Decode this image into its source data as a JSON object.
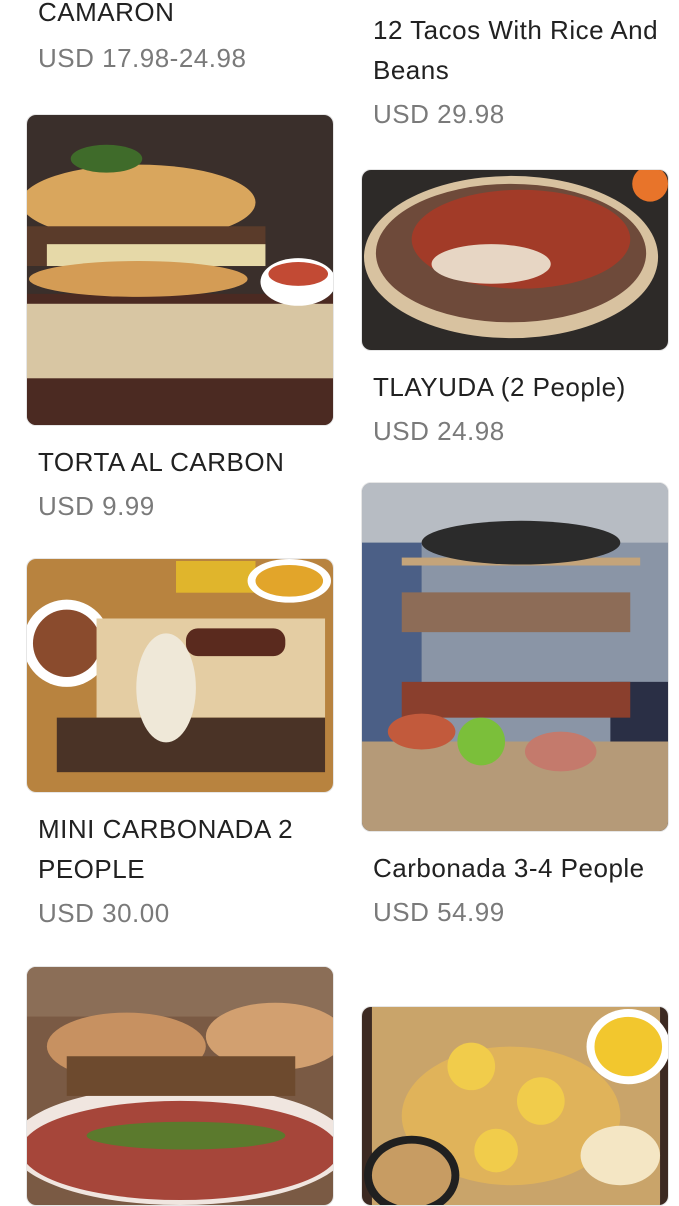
{
  "items": [
    {
      "name": "CAMARON",
      "price": "USD 17.98-24.98",
      "photo": "shrimp-dish"
    },
    {
      "name": "12 Tacos With Rice And Beans",
      "price": "USD 29.98",
      "photo": "tacos"
    },
    {
      "name": "TORTA AL CARBON",
      "price": "USD 9.99",
      "photo": "torta-sandwich"
    },
    {
      "name": "TLAYUDA (2 People)",
      "price": "USD 24.98",
      "photo": "tlayuda"
    },
    {
      "name": "MINI CARBONADA 2 PEOPLE",
      "price": "USD 30.00",
      "photo": "grill-platter"
    },
    {
      "name": "Carbonada 3-4 People",
      "price": "USD 54.99",
      "photo": "tiered-grill-tower"
    },
    {
      "name": "",
      "price": "",
      "photo": "sandwich-platter"
    },
    {
      "name": "",
      "price": "",
      "photo": "pineapple-chicken-board"
    }
  ]
}
